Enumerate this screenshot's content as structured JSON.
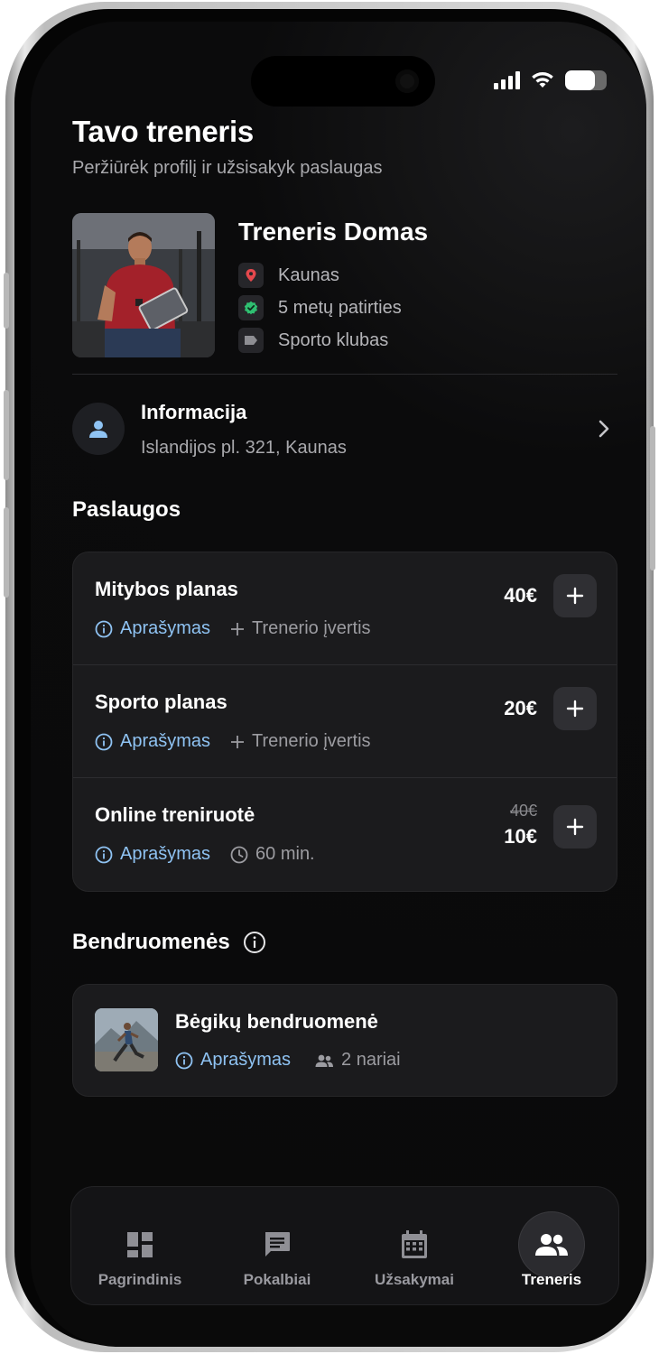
{
  "header": {
    "title": "Tavo treneris",
    "subtitle": "Peržiūrėk profilį ir užsisakyk paslaugas"
  },
  "trainer": {
    "name": "Treneris Domas",
    "meta": [
      {
        "icon": "location-pin-icon",
        "text": "Kaunas",
        "color": "#e5484d"
      },
      {
        "icon": "verified-badge-icon",
        "text": "5 metų patirties",
        "color": "#2fbf71"
      },
      {
        "icon": "tag-icon",
        "text": "Sporto klubas",
        "color": "#8e8e93"
      }
    ]
  },
  "info": {
    "title": "Informacija",
    "address": "Islandijos pl. 321, Kaunas"
  },
  "services": {
    "title": "Paslaugos",
    "items": [
      {
        "name": "Mitybos planas",
        "price": "40€",
        "link1": "Aprašymas",
        "link2": "Trenerio įvertis"
      },
      {
        "name": "Sporto planas",
        "price": "20€",
        "link1": "Aprašymas",
        "link2": "Trenerio įvertis"
      },
      {
        "name": "Online treniruotė",
        "old_price": "40€",
        "price": "10€",
        "link1": "Aprašymas",
        "link2": "60 min."
      }
    ]
  },
  "communities": {
    "title": "Bendruomenės",
    "items": [
      {
        "name": "Bėgikų bendruomenė",
        "link1": "Aprašymas",
        "members": "2 nariai"
      }
    ]
  },
  "tabbar": {
    "tabs": [
      {
        "label": "Pagrindinis",
        "icon": "dashboard-icon"
      },
      {
        "label": "Pokalbiai",
        "icon": "chat-icon"
      },
      {
        "label": "Užsakymai",
        "icon": "calendar-icon"
      },
      {
        "label": "Treneris",
        "icon": "people-icon",
        "active": true
      }
    ]
  },
  "colors": {
    "background": "#0a0a0a",
    "card": "#1b1b1d",
    "link_blue": "#8fc3f3"
  }
}
